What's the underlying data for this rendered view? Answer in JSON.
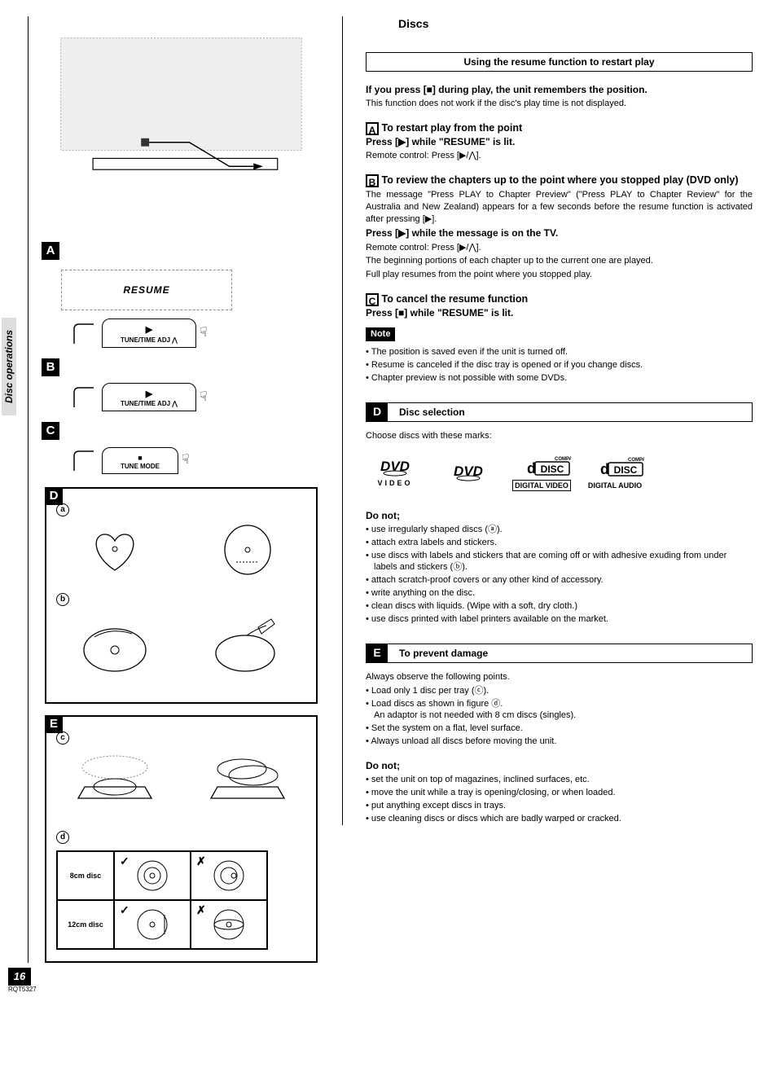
{
  "side_tab": "Disc operations",
  "page_number": "16",
  "page_code": "RQT5327",
  "left": {
    "display_text": "RESUME",
    "btn_A_label": "TUNE/TIME ADJ",
    "btn_B_label": "TUNE/TIME ADJ",
    "btn_C_label": "TUNE MODE",
    "play_icon": "▶",
    "stop_icon": "■",
    "eightcm": "8cm disc",
    "twelvecm": "12cm disc",
    "circ_a": "a",
    "circ_b": "b",
    "circ_c": "c",
    "circ_d": "d"
  },
  "right": {
    "title": "Discs",
    "resume_box": "Using the resume function to restart play",
    "intro_bold": "If you press [■] during play, the unit remembers the position.",
    "intro_body": "This function does not work if the disc's play time is not displayed.",
    "A_head": "To restart play from the point",
    "A_sub": "Press [▶] while \"RESUME\" is lit.",
    "A_body1": "Remote control: Press [▶/⋀].",
    "B_head": "To review the chapters up to the point where you stopped play (DVD only)",
    "B_body1": "The message \"Press PLAY to Chapter Preview\" (\"Press PLAY to Chapter Review\" for the Australia and New Zealand) appears for a few seconds before the resume function is activated after pressing [▶].",
    "B_sub": "Press [▶] while the message is on the TV.",
    "B_body2": "Remote control: Press [▶/⋀].",
    "B_body3": "The beginning portions of each chapter up to the current one are played.",
    "B_body4": "Full play resumes from the point where you stopped play.",
    "C_head": "To cancel the resume function",
    "C_sub": "Press [■] while \"RESUME\" is lit.",
    "note_label": "Note",
    "note_items": [
      "The position is saved even if the unit is turned off.",
      "Resume is canceled if the disc tray is opened or if you change discs.",
      "Chapter preview is not possible with some DVDs."
    ],
    "D_title": "Disc selection",
    "D_lead": "Choose discs with these marks:",
    "logos": {
      "dvd_video": "VIDEO",
      "dvd_audio": "",
      "cd_dv_top": "COMPACT",
      "cd_dv_bot": "DIGITAL VIDEO",
      "cd_da_top": "COMPACT",
      "cd_da_bot": "DIGITAL AUDIO"
    },
    "do_not_head": "Do not;",
    "do_not_items": [
      "use irregularly shaped discs (ⓐ).",
      "attach extra labels and stickers.",
      "use discs with labels and stickers that are coming off or with adhesive exuding from under labels and stickers (ⓑ).",
      "attach scratch-proof covers or any other kind of accessory.",
      "write anything on the disc.",
      "clean discs with liquids. (Wipe with a soft, dry cloth.)",
      "use discs printed with label printers available on the market."
    ],
    "E_title": "To prevent damage",
    "E_lead": "Always observe the following points.",
    "E_items": [
      "Load only 1 disc per tray (ⓒ).",
      "Load discs as shown in figure ⓓ.\nAn adaptor is not needed with 8 cm discs (singles).",
      "Set the system on a flat, level surface.",
      "Always unload all discs before moving the unit."
    ],
    "E_do_not_head": "Do not;",
    "E_do_not_items": [
      "set the unit on top of magazines, inclined surfaces, etc.",
      "move the unit while a tray is opening/closing, or when loaded.",
      "put anything except discs in trays.",
      "use cleaning discs or discs which are badly warped or cracked."
    ]
  }
}
